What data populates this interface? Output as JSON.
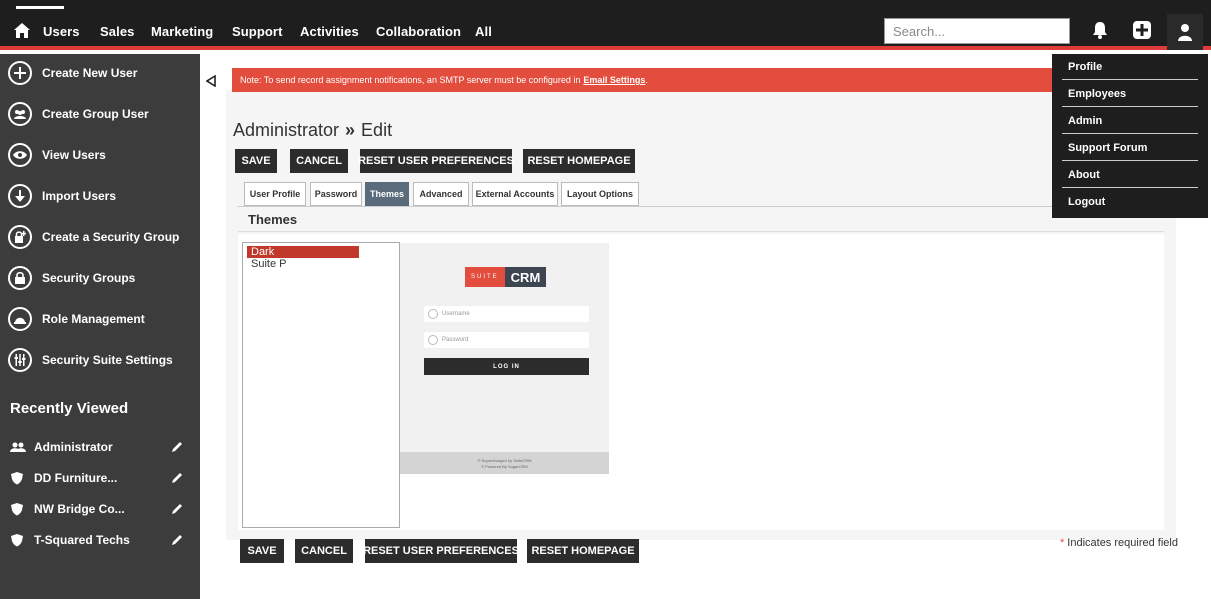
{
  "nav": {
    "items": [
      "Users",
      "Sales",
      "Marketing",
      "Support",
      "Activities",
      "Collaboration",
      "All"
    ],
    "search_placeholder": "Search..."
  },
  "sidebar": {
    "actions": [
      {
        "label": "Create New User",
        "icon": "plus-icon"
      },
      {
        "label": "Create Group User",
        "icon": "group-icon"
      },
      {
        "label": "View Users",
        "icon": "eye-icon"
      },
      {
        "label": "Import Users",
        "icon": "download-icon"
      },
      {
        "label": "Create a Security Group",
        "icon": "lock-plus-icon"
      },
      {
        "label": "Security Groups",
        "icon": "lock-icon"
      },
      {
        "label": "Role Management",
        "icon": "role-icon"
      },
      {
        "label": "Security Suite Settings",
        "icon": "sliders-icon"
      }
    ],
    "recently_viewed_title": "Recently Viewed",
    "recent": [
      {
        "label": "Administrator",
        "icon": "users-icon"
      },
      {
        "label": "DD Furniture...",
        "icon": "shield-icon"
      },
      {
        "label": "NW Bridge Co...",
        "icon": "shield-icon"
      },
      {
        "label": "T-Squared Techs",
        "icon": "shield-icon"
      }
    ]
  },
  "notice": {
    "text": "Note: To send record assignment notifications, an SMTP server must be configured in",
    "link": "Email Settings",
    "suffix": "."
  },
  "page": {
    "title_module": "Administrator",
    "title_sep": "»",
    "title_action": "Edit"
  },
  "buttons": {
    "save": "SAVE",
    "cancel": "CANCEL",
    "reset_prefs": "RESET USER PREFERENCES",
    "reset_home": "RESET HOMEPAGE"
  },
  "tabs": [
    "User Profile",
    "Password",
    "Themes",
    "Advanced",
    "External Accounts",
    "Layout Options"
  ],
  "active_tab": "Themes",
  "themes": {
    "section_title": "Themes",
    "options": [
      "Dark",
      "Suite P"
    ],
    "selected": "Dark"
  },
  "preview": {
    "logo_suite": "SUITE",
    "logo_crm": "CRM",
    "username_placeholder": "Username",
    "password_placeholder": "Password",
    "login_label": "LOG IN",
    "footer_line1": "© Supercharged by SuiteCRM",
    "footer_line2": "© Powered By SugarCRM"
  },
  "required_note": {
    "star": "*",
    "text": "Indicates required field"
  },
  "user_menu": [
    "Profile",
    "Employees",
    "Admin",
    "Support Forum",
    "About",
    "Logout"
  ],
  "colors": {
    "accent": "#e24d3d",
    "nav_bg": "#1e1e1e",
    "sidebar_bg": "#3c3c3c",
    "active_tab": "#5a6b7b"
  }
}
